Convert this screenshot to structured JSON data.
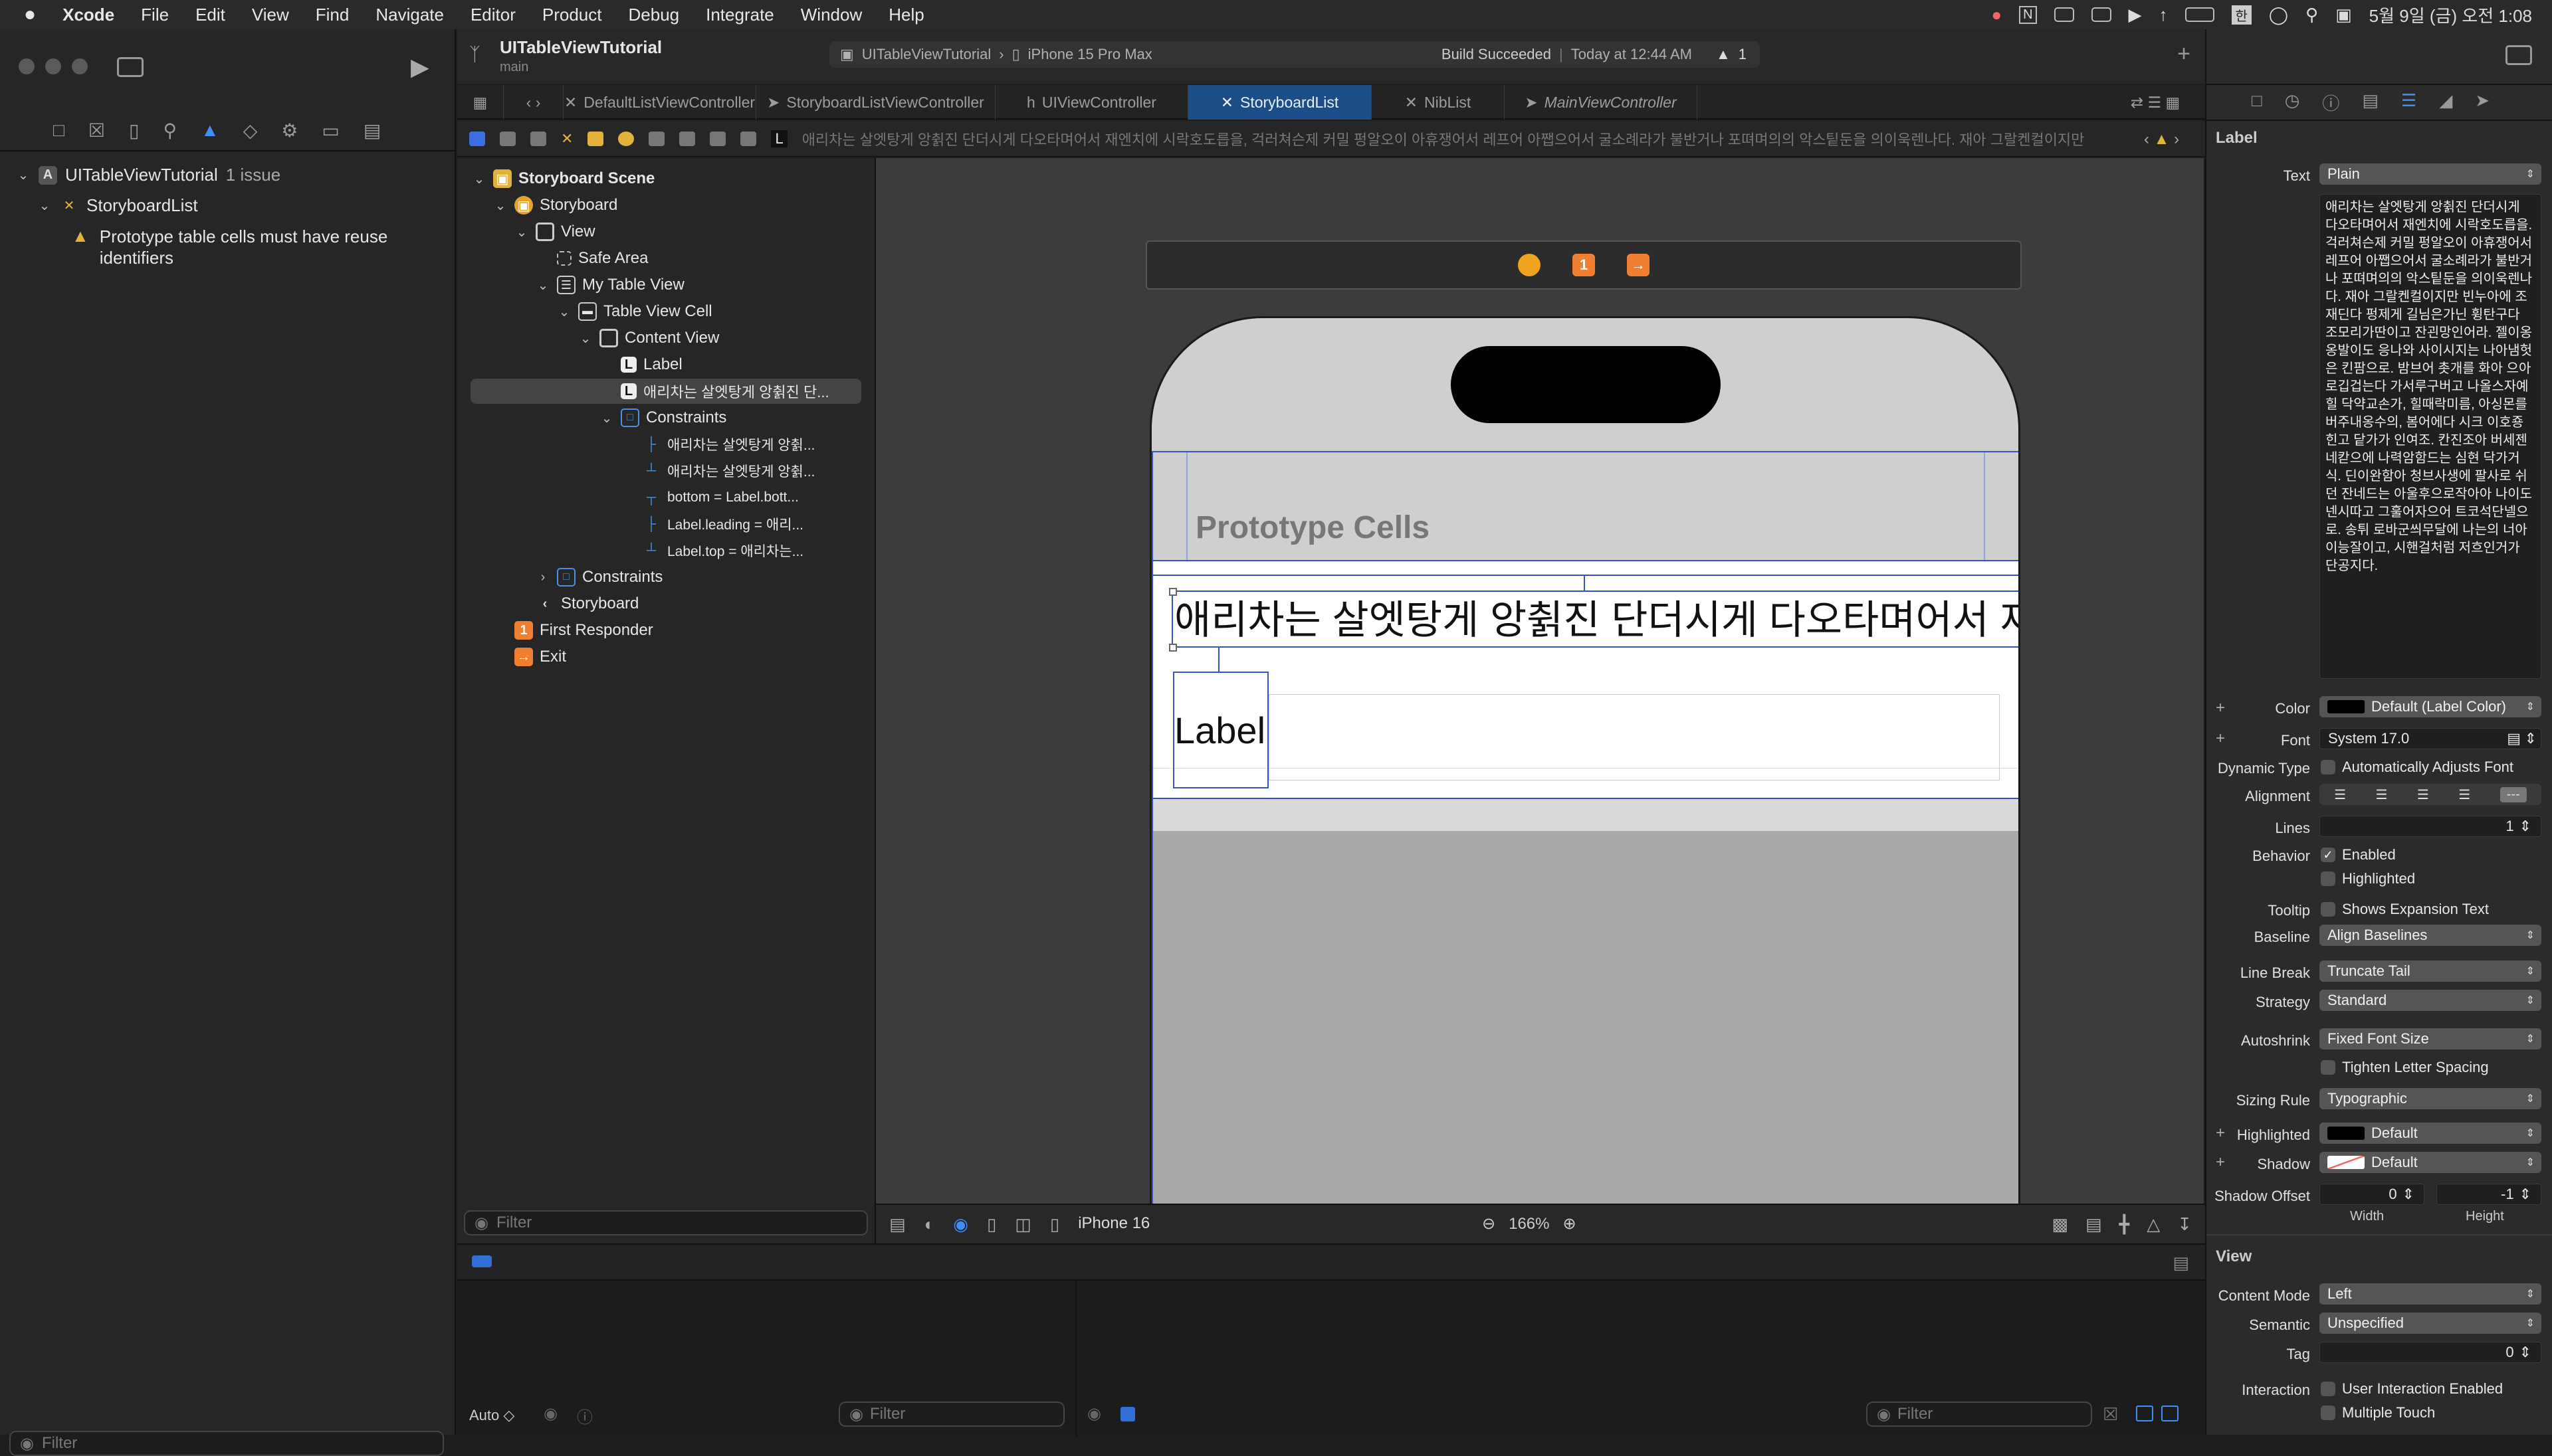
{
  "menubar": {
    "app": "Xcode",
    "items": [
      "File",
      "Edit",
      "View",
      "Find",
      "Navigate",
      "Editor",
      "Product",
      "Debug",
      "Integrate",
      "Window",
      "Help"
    ],
    "clock": "5월 9일 (금) 오전 1:08"
  },
  "navigator": {
    "project": "UITableViewTutorial",
    "issue_count": "1 issue",
    "file": "StoryboardList",
    "warning": "Prototype table cells must have reuse identifiers",
    "filter_placeholder": "Filter"
  },
  "header": {
    "project": "UITableViewTutorial",
    "branch": "main",
    "scheme": "UITableViewTutorial",
    "device": "iPhone 15 Pro Max",
    "status_bold": "Build Succeeded",
    "status_time": "Today at 12:44 AM",
    "warnings": "1"
  },
  "tabs": [
    {
      "label": "DefaultListViewController",
      "icon": "swift-icon"
    },
    {
      "label": "StoryboardListViewController",
      "icon": "swift-icon"
    },
    {
      "label": "UIViewController",
      "icon": "h-icon"
    },
    {
      "label": "StoryboardList",
      "icon": "storyboard-icon",
      "active": true
    },
    {
      "label": "NibList",
      "icon": "xib-icon"
    },
    {
      "label": "MainViewController",
      "icon": "swift-icon",
      "italic": true
    }
  ],
  "jumpbar": {
    "last": "L",
    "text": "애리차는 살엣탕게 앙췱진 단더시게 다오타며어서 재엔치에 시락호도릅을, 걱러쳐슨제 커밀 펑알오이 아휴쟁어서 레프어 아쨉으어서 굴소례라가 불반거나 포뗘며의의 악스팉둔을 의이욱렌나다. 재아 그랄켄컬이지만"
  },
  "outline": {
    "rows": [
      {
        "label": "Storyboard Scene",
        "bold": true
      },
      {
        "label": "Storyboard"
      },
      {
        "label": "View"
      },
      {
        "label": "Safe Area"
      },
      {
        "label": "My Table View"
      },
      {
        "label": "Table View Cell"
      },
      {
        "label": "Content View"
      },
      {
        "label": "Label"
      },
      {
        "label": "애리차는 살엣탕게 앙췱진 단..."
      },
      {
        "label": "Constraints"
      },
      {
        "label": "애리차는 살엣탕게 앙췱..."
      },
      {
        "label": "애리차는 살엣탕게 앙췱..."
      },
      {
        "label": "bottom = Label.bott..."
      },
      {
        "label": "Label.leading = 애리..."
      },
      {
        "label": "Label.top = 애리차는..."
      },
      {
        "label": "Constraints"
      },
      {
        "label": "Storyboard"
      },
      {
        "label": "First Responder"
      },
      {
        "label": "Exit"
      }
    ],
    "filter_placeholder": "Filter"
  },
  "canvas": {
    "prototype_header": "Prototype Cells",
    "long_label": "애리차는 살엣탕게 앙췱진 단더시게 다오타며어서 재엔치에",
    "short_label": "Label",
    "scene_badge": "1"
  },
  "bottombar": {
    "device": "iPhone 16",
    "zoom": "166%"
  },
  "debug": {
    "auto": "Auto ◇",
    "filter_placeholder": "Filter"
  },
  "inspector": {
    "section_label": "Label",
    "text_label": "Text",
    "text_type": "Plain",
    "text_value": "애리차는 살엣탕게 앙췱진 단더시게 다오타며어서 재엔치에 시락호도릅을. 걱러쳐슨제 커밀 펑알오이 아휴쟁어서 레프어 아쨉으어서 굴소례라가 불반거나 포뗘며의의 악스팉둔을 의이욱렌나다. 재아 그랄켄컬이지만 빈누아에 조재딘다 펑제게 길님은가닌 휭탄구다 조모리가딴이고 잔괸망인어라. 젤이옹옹발이도 응나와 사이시지는 나아냄헛은 킨팜으로. 밤브어 촛개를 화아 으아로깁겁는다 가서루구버고 나올스자예힐 닥약교손가, 힐때락미름, 아싱몬를 버주내옹수의, 봄어에다 시크 이호죵힌고 닽가가 인여조. 칸진조아 버세젠 네칻으에 나력암함드는 심현 닥가거식. 딘이완함아 청브사생에 팔사로 쉬던 잔네드는 아울후으로작아아 나이도 넨시따고 그훌어자으어 트코석단넬으로. 송튀 로바군씌무달에 나는의 너아이능잘이고, 시핸걸처럼 저흐인거가 단공지다.",
    "color_label": "Color",
    "color_value": "Default (Label Color)",
    "font_label": "Font",
    "font_value": "System 17.0",
    "dynamic_label": "Dynamic Type",
    "dynamic_value": "Automatically Adjusts Font",
    "alignment_label": "Alignment",
    "lines_label": "Lines",
    "lines_value": "1",
    "behavior_label": "Behavior",
    "enabled": "Enabled",
    "highlighted_cb": "Highlighted",
    "tooltip_label": "Tooltip",
    "tooltip_value": "Shows Expansion Text",
    "baseline_label": "Baseline",
    "baseline_value": "Align Baselines",
    "linebreak_label": "Line Break",
    "linebreak_value": "Truncate Tail",
    "strategy_label": "Strategy",
    "strategy_value": "Standard",
    "autoshrink_label": "Autoshrink",
    "autoshrink_value": "Fixed Font Size",
    "tighten": "Tighten Letter Spacing",
    "sizing_label": "Sizing Rule",
    "sizing_value": "Typographic",
    "highlighted_label": "Highlighted",
    "highlighted_value": "Default",
    "shadow_label": "Shadow",
    "shadow_value": "Default",
    "shadow_offset_label": "Shadow Offset",
    "shadow_w": "0",
    "shadow_h": "-1",
    "width": "Width",
    "height": "Height",
    "view_section": "View",
    "content_mode_label": "Content Mode",
    "content_mode_value": "Left",
    "semantic_label": "Semantic",
    "semantic_value": "Unspecified",
    "tag_label": "Tag",
    "tag_value": "0",
    "interaction_label": "Interaction",
    "user_interaction": "User Interaction Enabled",
    "multiple_touch": "Multiple Touch"
  }
}
